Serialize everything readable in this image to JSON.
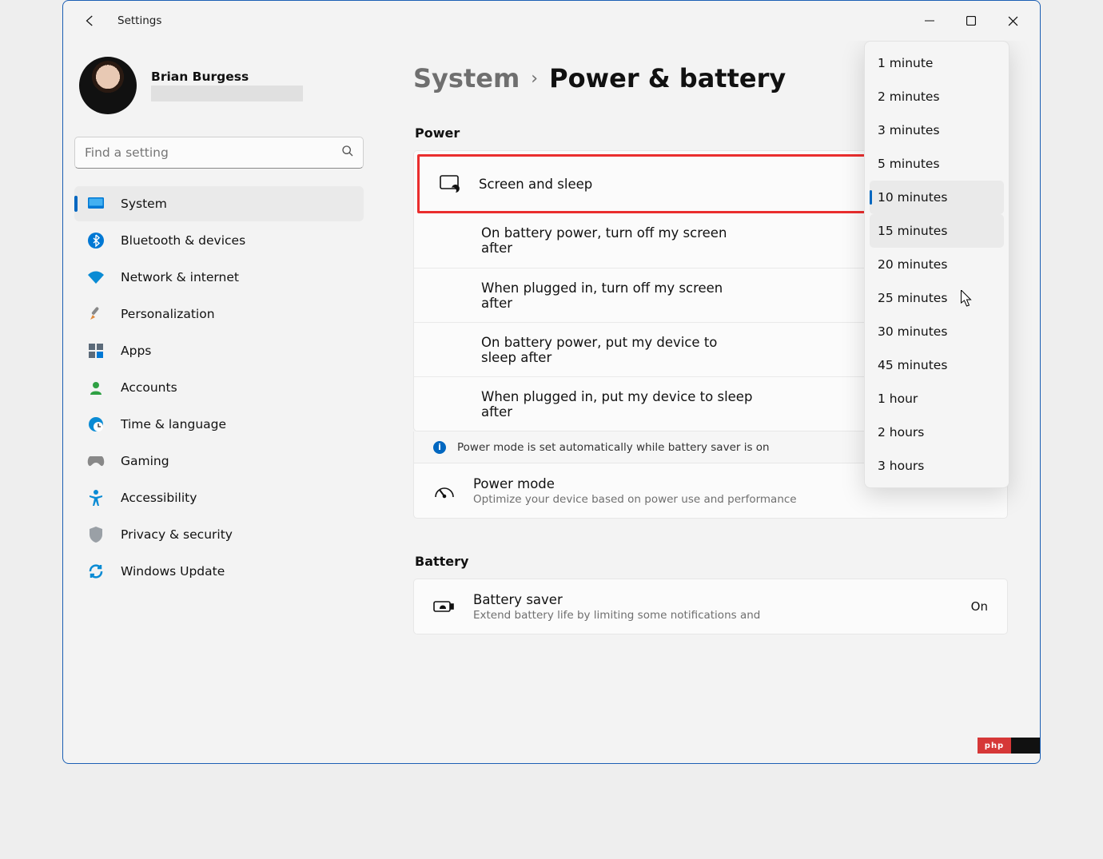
{
  "titlebar": {
    "title": "Settings"
  },
  "user": {
    "name": "Brian Burgess"
  },
  "search": {
    "placeholder": "Find a setting"
  },
  "sidebar": {
    "items": [
      {
        "label": "System",
        "icon": "system"
      },
      {
        "label": "Bluetooth & devices",
        "icon": "bluetooth"
      },
      {
        "label": "Network & internet",
        "icon": "network"
      },
      {
        "label": "Personalization",
        "icon": "personalization"
      },
      {
        "label": "Apps",
        "icon": "apps"
      },
      {
        "label": "Accounts",
        "icon": "accounts"
      },
      {
        "label": "Time & language",
        "icon": "time"
      },
      {
        "label": "Gaming",
        "icon": "gaming"
      },
      {
        "label": "Accessibility",
        "icon": "accessibility"
      },
      {
        "label": "Privacy & security",
        "icon": "privacy"
      },
      {
        "label": "Windows Update",
        "icon": "update"
      }
    ]
  },
  "breadcrumb": {
    "parent": "System",
    "sep": "›",
    "current": "Power & battery"
  },
  "sections": {
    "power": "Power",
    "battery": "Battery"
  },
  "screen_sleep": {
    "title": "Screen and sleep",
    "rows": [
      {
        "label": "On battery power, turn off my screen after",
        "value": ""
      },
      {
        "label": "When plugged in, turn off my screen after",
        "value": ""
      },
      {
        "label": "On battery power, put my device to sleep after",
        "value": ""
      },
      {
        "label": "When plugged in, put my device to sleep after",
        "value": ""
      }
    ]
  },
  "infobar": {
    "text": "Power mode is set automatically while battery saver is on"
  },
  "power_mode": {
    "title": "Power mode",
    "sub": "Optimize your device based on power use and performance"
  },
  "battery_saver": {
    "title": "Battery saver",
    "sub": "Extend battery life by limiting some notifications and",
    "value": "On"
  },
  "dropdown": {
    "options": [
      "1 minute",
      "2 minutes",
      "3 minutes",
      "5 minutes",
      "10 minutes",
      "15 minutes",
      "20 minutes",
      "25 minutes",
      "30 minutes",
      "45 minutes",
      "1 hour",
      "2 hours",
      "3 hours"
    ],
    "selected": "10 minutes",
    "hover": "15 minutes"
  },
  "logo": {
    "text": "php"
  }
}
